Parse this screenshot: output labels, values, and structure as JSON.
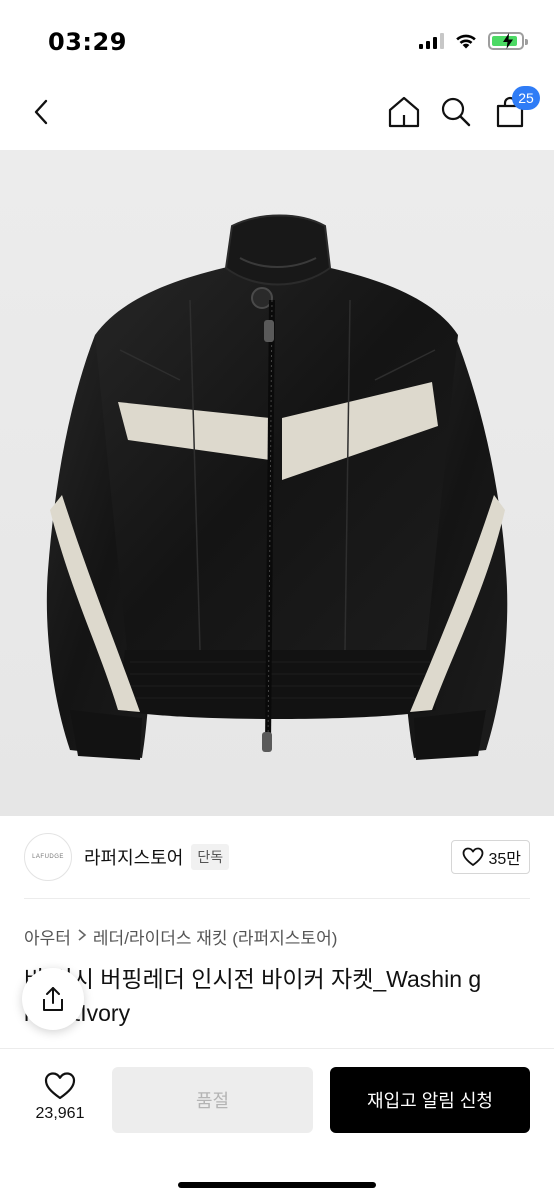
{
  "status_bar": {
    "time": "03:29",
    "icons": [
      "signal-icon",
      "wifi-icon",
      "battery-charging-icon"
    ]
  },
  "nav": {
    "back_icon": "chevron-left-icon",
    "home_icon": "home-icon",
    "search_icon": "search-icon",
    "cart_icon": "cart-icon",
    "cart_count": "25",
    "badge_color": "#2f7cf6"
  },
  "product_image": {
    "icon": "leather-biker-jacket-photo",
    "colors": {
      "leather": "#161616",
      "stripe": "#ddd9cd",
      "background": "#e9e9e9"
    }
  },
  "brand": {
    "logo_text": "LAFUDGE",
    "name": "라퍼지스토어",
    "badge": "단독",
    "like_count": "35만"
  },
  "breadcrumb": {
    "category": "아우터",
    "subcategory": "레더/라이더스 재킷 (라퍼지스토어)"
  },
  "product": {
    "title": "바 워시 버핑레더 인시전 바이커 자켓_Washin g lack&Ivory"
  },
  "bottom_bar": {
    "wish_count": "23,961",
    "soldout_label": "품절",
    "restock_label": "재입고 알림 신청"
  }
}
